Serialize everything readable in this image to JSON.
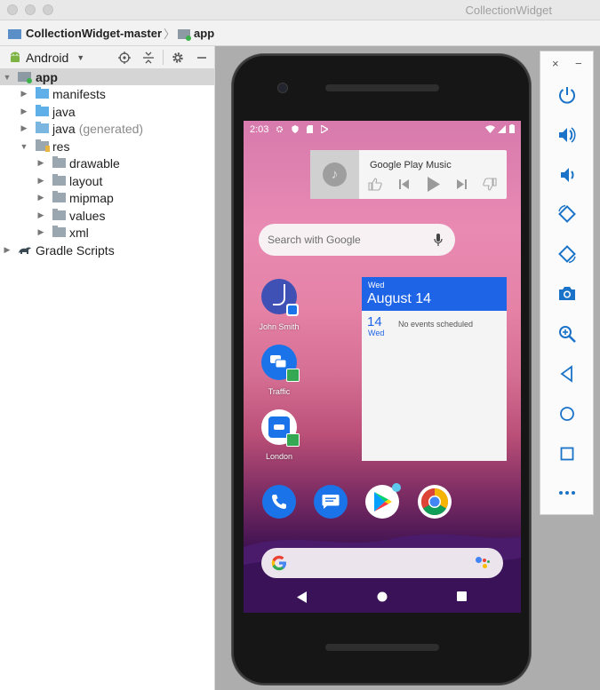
{
  "window": {
    "title": "CollectionWidget"
  },
  "breadcrumb": {
    "project": "CollectionWidget-master",
    "module": "app",
    "separator": "〉"
  },
  "project_panel": {
    "view_mode": "Android",
    "tree": [
      {
        "label": "app",
        "level": 0,
        "expanded": true,
        "selected": true,
        "icon": "module-icon"
      },
      {
        "label": "manifests",
        "level": 1,
        "expanded": false,
        "icon": "folder-icon"
      },
      {
        "label": "java",
        "level": 1,
        "expanded": false,
        "icon": "folder-icon"
      },
      {
        "label": "java",
        "suffix": "(generated)",
        "level": 1,
        "expanded": false,
        "icon": "generated-folder-icon"
      },
      {
        "label": "res",
        "level": 1,
        "expanded": true,
        "icon": "res-folder-icon"
      },
      {
        "label": "drawable",
        "level": 2,
        "expanded": false,
        "icon": "folder-icon"
      },
      {
        "label": "layout",
        "level": 2,
        "expanded": false,
        "icon": "folder-icon"
      },
      {
        "label": "mipmap",
        "level": 2,
        "expanded": false,
        "icon": "folder-icon"
      },
      {
        "label": "values",
        "level": 2,
        "expanded": false,
        "icon": "folder-icon"
      },
      {
        "label": "xml",
        "level": 2,
        "expanded": false,
        "icon": "folder-icon"
      },
      {
        "label": "Gradle Scripts",
        "level": 0,
        "expanded": false,
        "icon": "gradle-icon"
      }
    ]
  },
  "emulator": {
    "status": {
      "time": "2:03"
    },
    "music_widget": {
      "title": "Google Play Music"
    },
    "search": {
      "placeholder": "Search with Google"
    },
    "shortcuts": [
      {
        "label": "John Smith",
        "icon": "contact-icon"
      },
      {
        "label": "Traffic",
        "icon": "traffic-icon"
      },
      {
        "label": "London",
        "icon": "directions-icon"
      }
    ],
    "calendar": {
      "header_day": "Wed",
      "header_date": "August 14",
      "day_num": "14",
      "day_name": "Wed",
      "message": "No events scheduled"
    },
    "dock": [
      {
        "name": "phone-app-icon",
        "color": "#1a73e8"
      },
      {
        "name": "messages-app-icon",
        "color": "#1a73e8"
      },
      {
        "name": "play-store-app-icon",
        "color": "#ffffff"
      },
      {
        "name": "chrome-app-icon",
        "color": "#ffffff"
      }
    ],
    "colors": {
      "accent": "#1e64e6",
      "wallpaper_top": "#d77aad",
      "wallpaper_bottom": "#22073a"
    }
  },
  "emulator_controls": {
    "window_buttons": [
      "×",
      "−"
    ],
    "buttons": [
      "power-icon",
      "volume-up-icon",
      "volume-down-icon",
      "rotate-left-icon",
      "rotate-right-icon",
      "camera-icon",
      "zoom-icon",
      "back-icon",
      "home-icon",
      "overview-icon",
      "more-icon"
    ]
  }
}
